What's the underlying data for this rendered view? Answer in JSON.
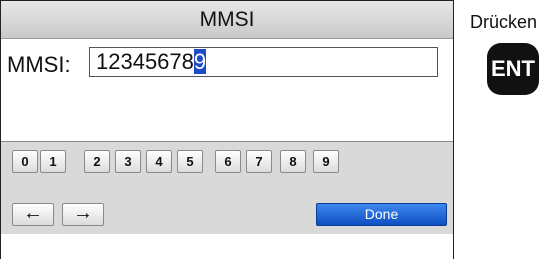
{
  "title": "MMSI",
  "mmsi": {
    "label": "MMSI:",
    "value_before_cursor": "12345678",
    "cursor_char": "9"
  },
  "keypad": {
    "keys": [
      "0",
      "1",
      "2",
      "3",
      "4",
      "5",
      "6",
      "7",
      "8",
      "9"
    ],
    "left_arrow": "←",
    "right_arrow": "→",
    "done_label": "Done"
  },
  "hint": {
    "text": "Drücken",
    "key_label": "ENT"
  }
}
